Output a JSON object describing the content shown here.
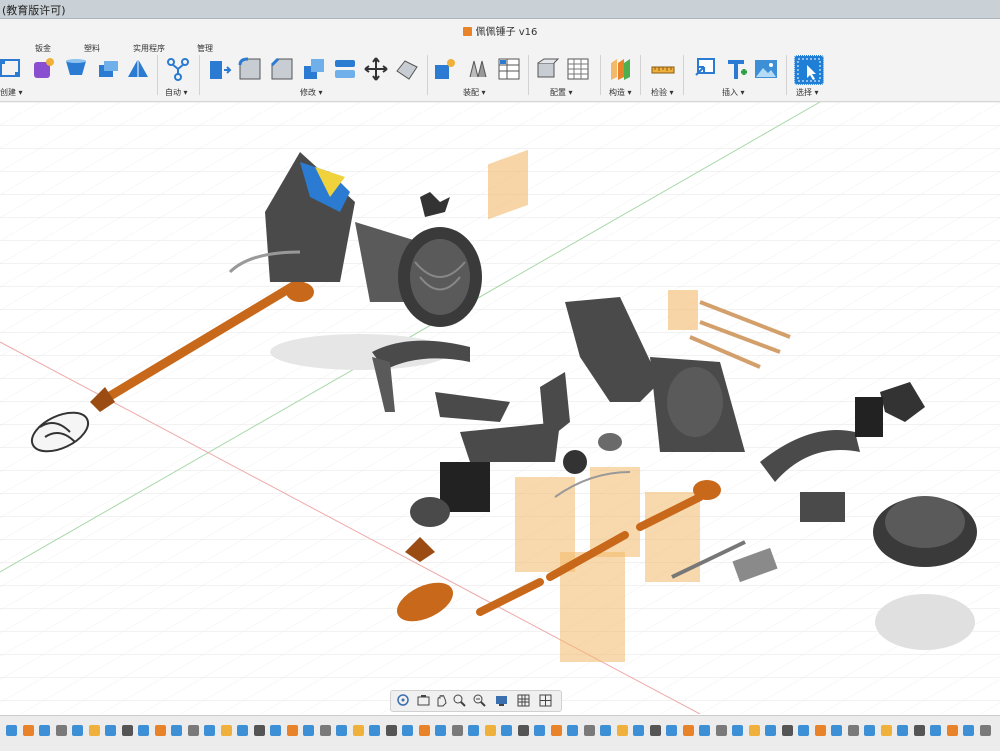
{
  "window": {
    "title_fragment": "(教育版许可)"
  },
  "document": {
    "title": "佩佩锤子 v16"
  },
  "ribbon": {
    "tabs": [
      "钣金",
      "塑料",
      "实用程序",
      "管理"
    ],
    "groups": [
      {
        "label": "创建 ▾",
        "icons": [
          "sketch-icon",
          "form-icon",
          "extrude-icon",
          "revolve-icon",
          "loft-icon"
        ]
      },
      {
        "label": "自动 ▾",
        "icons": [
          "automated-modeling-icon"
        ]
      },
      {
        "label": "修改 ▾",
        "icons": [
          "press-pull-icon",
          "fillet-icon",
          "chamfer-icon",
          "combine-icon",
          "shell-icon",
          "move-icon",
          "scale-icon"
        ]
      },
      {
        "label": "装配 ▾",
        "icons": [
          "new-component-icon",
          "joint-icon",
          "bom-icon"
        ]
      },
      {
        "label": "配置 ▾",
        "icons": [
          "configure-icon",
          "table-icon"
        ]
      },
      {
        "label": "构造 ▾",
        "icons": [
          "offset-plane-icon"
        ]
      },
      {
        "label": "检验 ▾",
        "icons": [
          "measure-icon"
        ]
      },
      {
        "label": "插入 ▾",
        "icons": [
          "insert-derive-icon",
          "insert-mesh-icon",
          "insert-image-icon"
        ]
      },
      {
        "label": "选择 ▾",
        "icons": [
          "select-icon"
        ]
      }
    ]
  },
  "viewport": {
    "axis_colors": {
      "x": "#e57373",
      "y": "#7fbf7f"
    },
    "part_colors": {
      "dark": "#4a4a4a",
      "wood": "#c8681a",
      "plane": "#f3b96a"
    }
  },
  "navbar": {
    "icons": [
      "orbit-icon",
      "look-at-icon",
      "pan-icon",
      "zoom-icon",
      "fit-icon",
      "display-settings-icon",
      "grid-settings-icon",
      "viewports-icon"
    ]
  },
  "timeline": {
    "count": 60
  }
}
